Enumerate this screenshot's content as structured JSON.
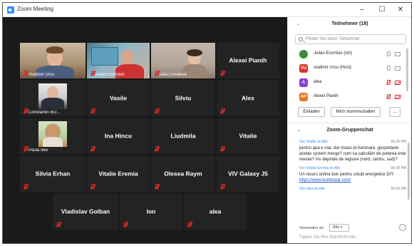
{
  "window": {
    "title": "Zoom Meeting",
    "minimize": "–",
    "maximize": "☐",
    "close": "✕"
  },
  "tiles": [
    {
      "name": "",
      "video_label": "Vladimir Ursu",
      "video": true
    },
    {
      "name": "",
      "video_label": "Julian EcoVisio",
      "video": true
    },
    {
      "name": "",
      "video_label": "Iulia Covalova",
      "video": true
    },
    {
      "name": "Alexei Pianih",
      "video_label": "",
      "video": false
    },
    {
      "name": "",
      "video_label": "Constantin BO...",
      "video": true
    },
    {
      "name": "Vasile",
      "video_label": "",
      "video": false
    },
    {
      "name": "Silviu",
      "video_label": "",
      "video": false
    },
    {
      "name": "Alex",
      "video_label": "",
      "video": false
    },
    {
      "name": "",
      "video_label": "Paula Iliev",
      "video": true
    },
    {
      "name": "Ina Hincu",
      "video_label": "",
      "video": false
    },
    {
      "name": "Liudmila",
      "video_label": "",
      "video": false
    },
    {
      "name": "Vitalie",
      "video_label": "",
      "video": false
    },
    {
      "name": "Silvia Erhan",
      "video_label": "",
      "video": false
    },
    {
      "name": "Vitalie Eremia",
      "video_label": "",
      "video": false
    },
    {
      "name": "Olesea Raym",
      "video_label": "",
      "video": false
    },
    {
      "name": "VIV Galaxy J5",
      "video_label": "",
      "video": false
    },
    {
      "name": "Vladislav Golban",
      "video_label": "",
      "video": false
    },
    {
      "name": "Ion",
      "video_label": "",
      "video": false
    },
    {
      "name": "alea",
      "video_label": "",
      "video": false
    }
  ],
  "participants": {
    "title": "Teilnehmer (18)",
    "search_placeholder": "Finden Sie einen Teilnehmer",
    "list": [
      {
        "initials": "",
        "name": "Julian EcoVisio (Ich)",
        "color": "#3a8a3a",
        "muted": false,
        "cam_off": false
      },
      {
        "initials": "VU",
        "name": "vladimir Ursu (Host)",
        "color": "#d9342b",
        "muted": false,
        "cam_off": false
      },
      {
        "initials": "A",
        "name": "alea",
        "color": "#8b3fd6",
        "muted": true,
        "cam_off": true
      },
      {
        "initials": "AP",
        "name": "Alexei Pianih",
        "color": "#e8741c",
        "muted": true,
        "cam_off": true
      }
    ],
    "invite_label": "Einladen",
    "mute_all_label": "Mich stummschalten",
    "more_label": "..."
  },
  "chat": {
    "title": "Zoom-Gruppenchat",
    "messages": [
      {
        "from": "Von Vitalie an Alle",
        "time": "06:35 PM",
        "text": "pentru apa e clar, dar insasi pt iluminare, gospodarie acelas system merge? cum sa calculăm de puterea este nevoie? ms depinde de regiune (nord, centru, sud)?",
        "link": ""
      },
      {
        "from": "Von Vitalie Eremia an Alle",
        "time": "06:39 PM",
        "text": "Un resurs online bun pentru soluții energetice DIY:",
        "link": "https://www.buildsolar.com/"
      },
      {
        "from": "Von alea an Alle",
        "time": "06:39 PM",
        "text": "",
        "link": ""
      }
    ],
    "send_to_label": "Versenden an:",
    "send_to_value": "Alle",
    "file_icon": "...",
    "input_placeholder": "Tippen Sie Ihre Nachricht hier..."
  }
}
